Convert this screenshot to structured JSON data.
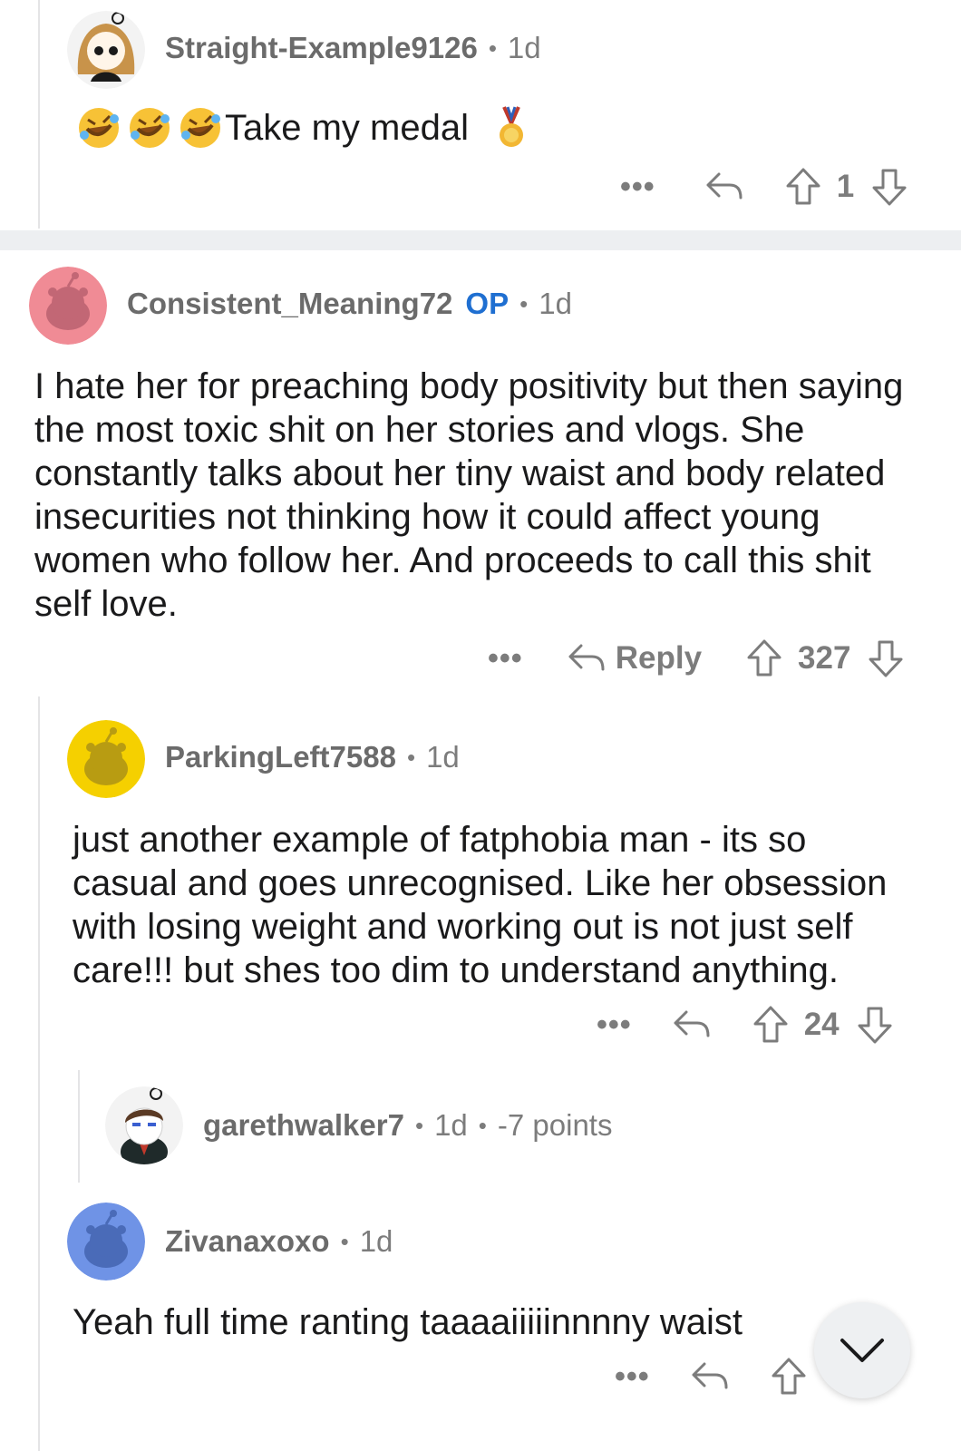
{
  "comments": [
    {
      "username": "Straight-Example9126",
      "age": "1d",
      "text": "Take my medal",
      "vote_count": "1",
      "avatar_color": "#f3f3f3"
    },
    {
      "username": "Consistent_Meaning72",
      "op_badge": "OP",
      "age": "1d",
      "text": "I hate her for preaching body positivity but then saying the most toxic shit on her stories and vlogs. She constantly talks about her tiny waist and body related insecurities not thinking how it could affect young women who follow her. And proceeds to call this shit self love.",
      "reply_label": "Reply",
      "vote_count": "327",
      "avatar_color": "#f08b95"
    },
    {
      "username": "ParkingLeft7588",
      "age": "1d",
      "text": "just another example of fatphobia man - its so casual and goes unrecognised. Like her obsession with losing weight and working out is not just self care!!! but shes too dim to understand anything.",
      "vote_count": "24",
      "avatar_color": "#f5d000"
    },
    {
      "username": "garethwalker7",
      "age": "1d",
      "points": "-7 points",
      "collapsed": true
    },
    {
      "username": "Zivanaxoxo",
      "age": "1d",
      "text": "Yeah full time ranting taaaaiiiiinnnny waist",
      "avatar_color": "#6f93e6"
    }
  ],
  "icons": {
    "more": "more-options-icon",
    "reply": "reply-arrow-icon",
    "upvote": "upvote-arrow-icon",
    "downvote": "downvote-arrow-icon",
    "scroll": "chevron-down-icon",
    "emoji": "rolling-on-floor-laughing-emoji",
    "medal": "medal-emoji"
  },
  "colors": {
    "op_badge": "#1f6fd1",
    "meta_text": "#7c7c7c",
    "separator": "#edeff1"
  }
}
